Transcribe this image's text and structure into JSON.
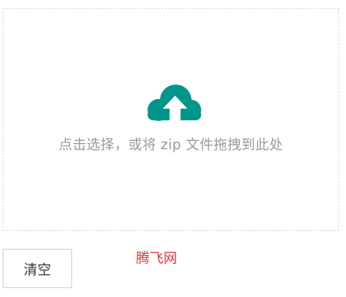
{
  "upload": {
    "icon": "cloud-upload-icon",
    "icon_color": "#00968a",
    "hint": "点击选择，或将 zip 文件拖拽到此处"
  },
  "actions": {
    "clear_label": "清空"
  },
  "brand": {
    "text": "腾飞网",
    "color": "#e0393e"
  }
}
